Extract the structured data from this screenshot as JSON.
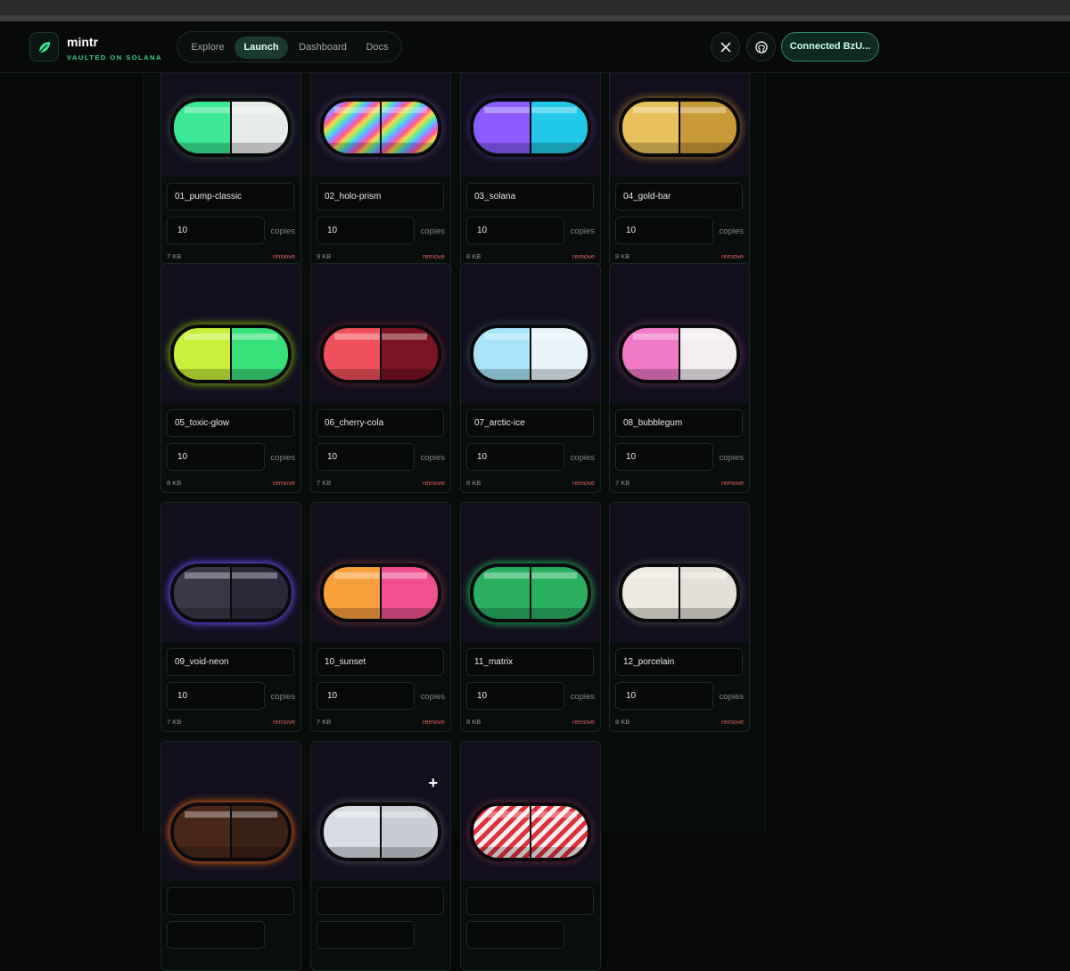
{
  "nav": {
    "brand": "mintr",
    "tagline": "VAULTED ON SOLANA",
    "tabs": [
      "Explore",
      "Launch",
      "Dashboard",
      "Docs"
    ],
    "active_tab": "Launch",
    "connect_label": "Connected BzU..."
  },
  "uploads": [
    {
      "name": "01_pump-classic",
      "copies": "10",
      "copies_label": "copies",
      "size": "7 KB",
      "remove": "remove",
      "left": "#3be893",
      "right": "#e8ece9",
      "glow": "#2a3a34"
    },
    {
      "name": "02_holo-prism",
      "copies": "10",
      "copies_label": "copies",
      "size": "9 KB",
      "remove": "remove",
      "left": "rainbow",
      "right": "rainbow",
      "glow": "#3a3050"
    },
    {
      "name": "03_solana",
      "copies": "10",
      "copies_label": "copies",
      "size": "8 KB",
      "remove": "remove",
      "left": "#8a5cff",
      "right": "#22c8e8",
      "glow": "#2a2850"
    },
    {
      "name": "04_gold-bar",
      "copies": "10",
      "copies_label": "copies",
      "size": "8 KB",
      "remove": "remove",
      "left": "#e8c15a",
      "right": "#c99a38",
      "glow": "#7a5a20"
    },
    {
      "name": "05_toxic-glow",
      "copies": "10",
      "copies_label": "copies",
      "size": "8 KB",
      "remove": "remove",
      "left": "#c8f03a",
      "right": "#38e07a",
      "glow": "#6a9a10"
    },
    {
      "name": "06_cherry-cola",
      "copies": "10",
      "copies_label": "copies",
      "size": "7 KB",
      "remove": "remove",
      "left": "#f0505a",
      "right": "#7a1420",
      "glow": "#4a1a28"
    },
    {
      "name": "07_arctic-ice",
      "copies": "10",
      "copies_label": "copies",
      "size": "8 KB",
      "remove": "remove",
      "left": "#a8e4f8",
      "right": "#e8f4fa",
      "glow": "#2a3a48"
    },
    {
      "name": "08_bubblegum",
      "copies": "10",
      "copies_label": "copies",
      "size": "7 KB",
      "remove": "remove",
      "left": "#f07ac8",
      "right": "#f4eef2",
      "glow": "#4a2a48"
    },
    {
      "name": "09_void-neon",
      "copies": "10",
      "copies_label": "copies",
      "size": "7 KB",
      "remove": "remove",
      "left": "#3a3848",
      "right": "#2a2838",
      "glow": "#6a48e8"
    },
    {
      "name": "10_sunset",
      "copies": "10",
      "copies_label": "copies",
      "size": "7 KB",
      "remove": "remove",
      "left": "#f8a03a",
      "right": "#f05090",
      "glow": "#5a2a30"
    },
    {
      "name": "11_matrix",
      "copies": "10",
      "copies_label": "copies",
      "size": "8 KB",
      "remove": "remove",
      "left": "#28b060",
      "right": "#28b060",
      "glow": "#1a9a48"
    },
    {
      "name": "12_porcelain",
      "copies": "10",
      "copies_label": "copies",
      "size": "8 KB",
      "remove": "remove",
      "left": "#eeeae2",
      "right": "#e4e0d8",
      "glow": "#3a3a3e"
    },
    {
      "name": "",
      "copies": "",
      "copies_label": "",
      "size": "",
      "remove": "",
      "left": "#4a2818",
      "right": "#3a2014",
      "glow": "#c85a10"
    },
    {
      "name": "",
      "copies": "",
      "copies_label": "",
      "size": "",
      "remove": "",
      "left": "#d8dce4",
      "right": "#c8ccd4",
      "glow": "#3a3e48",
      "plus": "+"
    },
    {
      "name": "",
      "copies": "",
      "copies_label": "",
      "size": "",
      "remove": "",
      "left": "stripes",
      "right": "stripes",
      "glow": "#4a2030"
    }
  ]
}
